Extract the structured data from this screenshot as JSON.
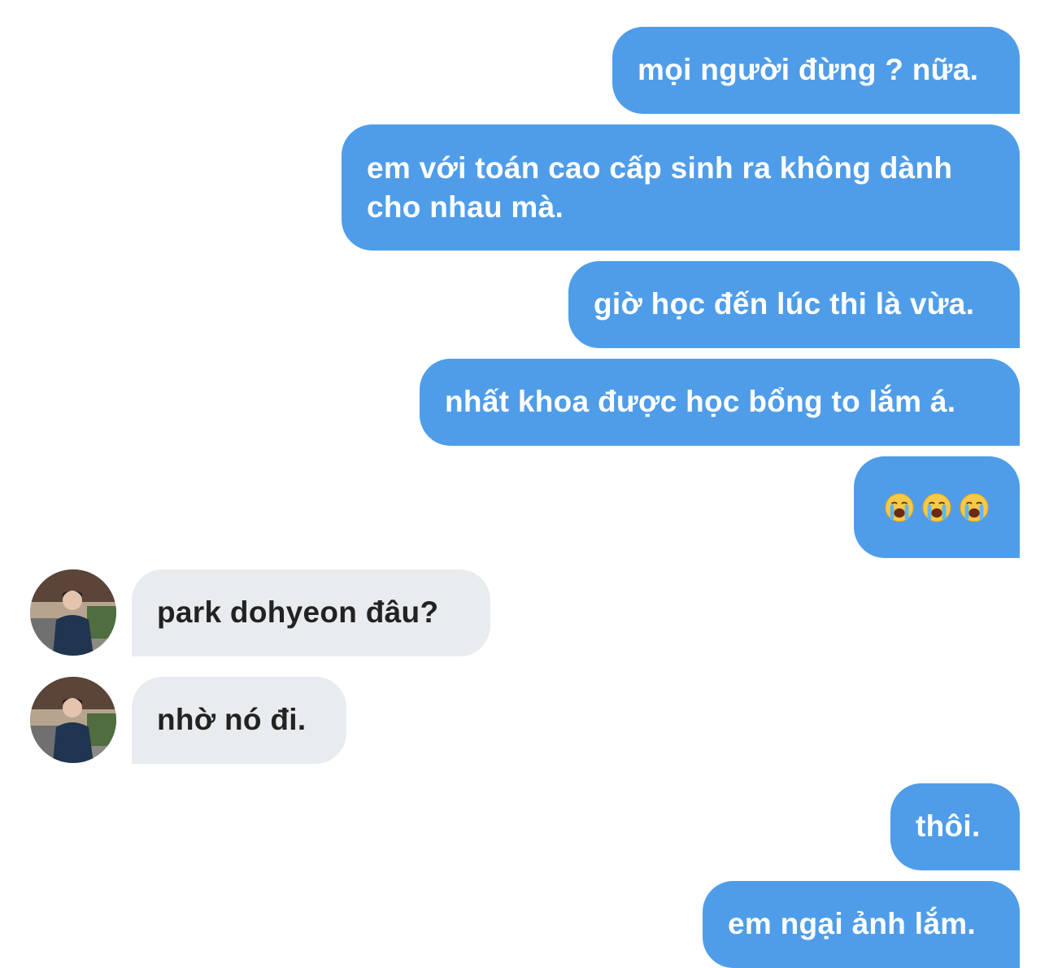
{
  "conversation": {
    "messages": [
      {
        "sender": "me",
        "text": "mọi người đừng ? nữa."
      },
      {
        "sender": "me",
        "text": "em với toán cao cấp sinh ra không dành",
        "text_line2": "cho nhau mà."
      },
      {
        "sender": "me",
        "text": "giờ học đến lúc thi là vừa."
      },
      {
        "sender": "me",
        "text": "nhất khoa được học bổng to lắm á."
      },
      {
        "sender": "me",
        "emoji": [
          "loudly-crying-face",
          "loudly-crying-face",
          "loudly-crying-face"
        ]
      },
      {
        "sender": "other",
        "text": "park dohyeon đâu?"
      },
      {
        "sender": "other",
        "text": "nhờ nó đi."
      },
      {
        "sender": "me",
        "text": "thôi."
      },
      {
        "sender": "me",
        "text": "em ngại ảnh lắm."
      }
    ]
  },
  "colors": {
    "outgoing_bubble": "#4f9de9",
    "incoming_bubble": "#e8ecef",
    "outgoing_text": "#ffffff",
    "incoming_text": "#222222"
  }
}
